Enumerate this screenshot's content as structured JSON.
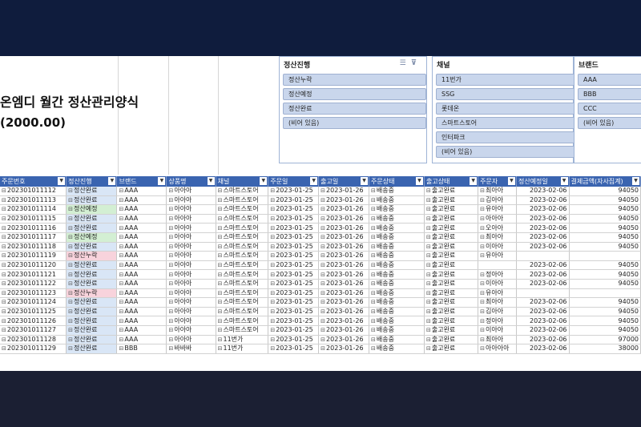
{
  "title": "온엠디 월간 정산관리양식",
  "subtitle": "(2000.00)",
  "slicers": [
    {
      "title": "정산진행",
      "items": [
        {
          "label": "정산누락",
          "selected": true
        },
        {
          "label": "정산예정",
          "selected": true
        },
        {
          "label": "정산완료",
          "selected": true
        },
        {
          "label": "(비어 있음)",
          "selected": true
        }
      ]
    },
    {
      "title": "채널",
      "items": [
        {
          "label": "11번가",
          "selected": true
        },
        {
          "label": "SSG",
          "selected": true
        },
        {
          "label": "롯데온",
          "selected": true
        },
        {
          "label": "스마트스토어",
          "selected": true
        },
        {
          "label": "인터파크",
          "selected": true
        },
        {
          "label": "(비어 있음)",
          "selected": true
        }
      ]
    },
    {
      "title": "브랜드",
      "items": [
        {
          "label": "AAA",
          "selected": true
        },
        {
          "label": "BBB",
          "selected": true
        },
        {
          "label": "CCC",
          "selected": true
        },
        {
          "label": "(비어 있음)",
          "selected": true
        }
      ]
    }
  ],
  "columns": [
    "주문번호",
    "정산진행",
    "브랜드",
    "상품명",
    "채널",
    "주문일",
    "출고일",
    "주문상태",
    "출고상태",
    "주문자",
    "정산예정일",
    "결제금액(자사집계)"
  ],
  "rows": [
    [
      "202301011112",
      "정산완료",
      "AAA",
      "아아아",
      "스마트스토어",
      "2023-01-25",
      "2023-01-26",
      "배송중",
      "출고완료",
      "최아아",
      "2023-02-06",
      "94050"
    ],
    [
      "202301011113",
      "정산완료",
      "AAA",
      "아아아",
      "스마트스토어",
      "2023-01-25",
      "2023-01-26",
      "배송중",
      "출고완료",
      "김아아",
      "2023-02-06",
      "94050"
    ],
    [
      "202301011114",
      "정산예정",
      "AAA",
      "아아아",
      "스마트스토어",
      "2023-01-25",
      "2023-01-26",
      "배송중",
      "출고완료",
      "유아아",
      "2023-02-06",
      "94050"
    ],
    [
      "202301011115",
      "정산완료",
      "AAA",
      "아아아",
      "스마트스토어",
      "2023-01-25",
      "2023-01-26",
      "배송중",
      "출고완료",
      "아아아",
      "2023-02-06",
      "94050"
    ],
    [
      "202301011116",
      "정산완료",
      "AAA",
      "아아아",
      "스마트스토어",
      "2023-01-25",
      "2023-01-26",
      "배송중",
      "출고완료",
      "오아아",
      "2023-02-06",
      "94050"
    ],
    [
      "202301011117",
      "정산예정",
      "AAA",
      "아아아",
      "스마트스토어",
      "2023-01-25",
      "2023-01-26",
      "배송중",
      "출고완료",
      "최아아",
      "2023-02-06",
      "94050"
    ],
    [
      "202301011118",
      "정산완료",
      "AAA",
      "아아아",
      "스마트스토어",
      "2023-01-25",
      "2023-01-26",
      "배송중",
      "출고완료",
      "이아아",
      "2023-02-06",
      "94050"
    ],
    [
      "202301011119",
      "정산누락",
      "AAA",
      "아아아",
      "스마트스토어",
      "2023-01-25",
      "2023-01-26",
      "배송중",
      "출고완료",
      "유아아",
      "",
      ""
    ],
    [
      "202301011120",
      "정산완료",
      "AAA",
      "아아아",
      "스마트스토어",
      "2023-01-25",
      "2023-01-26",
      "배송중",
      "출고완료",
      "",
      "2023-02-06",
      "94050"
    ],
    [
      "202301011121",
      "정산완료",
      "AAA",
      "아아아",
      "스마트스토어",
      "2023-01-25",
      "2023-01-26",
      "배송중",
      "출고완료",
      "정아아",
      "2023-02-06",
      "94050"
    ],
    [
      "202301011122",
      "정산완료",
      "AAA",
      "아아아",
      "스마트스토어",
      "2023-01-25",
      "2023-01-26",
      "배송중",
      "출고완료",
      "이아아",
      "2023-02-06",
      "94050"
    ],
    [
      "202301011123",
      "정산누락",
      "AAA",
      "아아아",
      "스마트스토어",
      "2023-01-25",
      "2023-01-26",
      "배송중",
      "출고완료",
      "유아아",
      "",
      ""
    ],
    [
      "202301011124",
      "정산완료",
      "AAA",
      "아아아",
      "스마트스토어",
      "2023-01-25",
      "2023-01-26",
      "배송중",
      "출고완료",
      "최아아",
      "2023-02-06",
      "94050"
    ],
    [
      "202301011125",
      "정산완료",
      "AAA",
      "아아아",
      "스마트스토어",
      "2023-01-25",
      "2023-01-26",
      "배송중",
      "출고완료",
      "김아아",
      "2023-02-06",
      "94050"
    ],
    [
      "202301011126",
      "정산완료",
      "AAA",
      "아아아",
      "스마트스토어",
      "2023-01-25",
      "2023-01-26",
      "배송중",
      "출고완료",
      "정아아",
      "2023-02-06",
      "94050"
    ],
    [
      "202301011127",
      "정산완료",
      "AAA",
      "아아아",
      "스마트스토어",
      "2023-01-25",
      "2023-01-26",
      "배송중",
      "출고완료",
      "이아아",
      "2023-02-06",
      "94050"
    ],
    [
      "202301011128",
      "정산완료",
      "AAA",
      "아아아",
      "11번가",
      "2023-01-25",
      "2023-01-26",
      "배송중",
      "출고완료",
      "최아아",
      "2023-02-06",
      "97000"
    ],
    [
      "202301011129",
      "정산완료",
      "BBB",
      "바바바",
      "11번가",
      "2023-01-25",
      "2023-01-26",
      "배송중",
      "출고완료",
      "아아아아",
      "2023-02-06",
      "38000"
    ]
  ],
  "colors": {
    "header_bg": "#3a64b0",
    "status_done": "#d9e6f6",
    "status_plan": "#d3efd3",
    "status_miss": "#f8d3dc"
  }
}
